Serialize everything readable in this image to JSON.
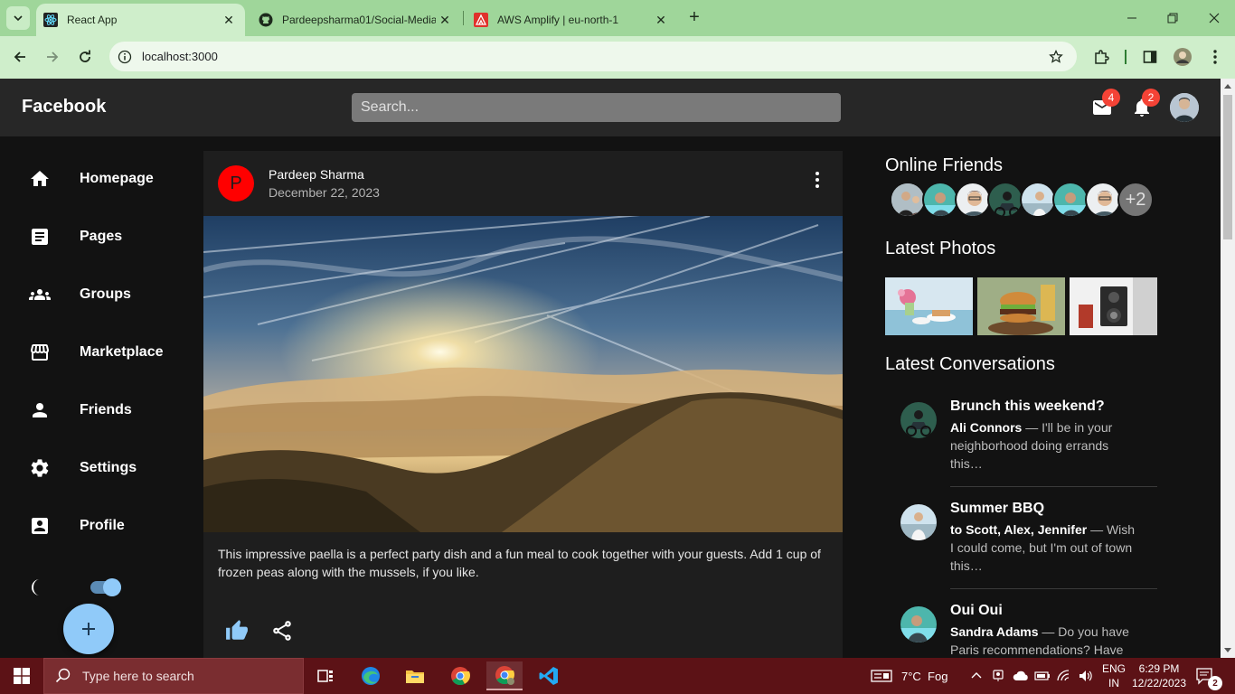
{
  "browser": {
    "tabs": [
      {
        "title": "React App",
        "icon": "react-icon",
        "active": true
      },
      {
        "title": "Pardeepsharma01/Social-Media",
        "icon": "github-icon",
        "active": false
      },
      {
        "title": "AWS Amplify | eu-north-1",
        "icon": "aws-amplify-icon",
        "active": false
      }
    ],
    "url": "localhost:3000",
    "accent": "#9fd69a"
  },
  "header": {
    "logo": "Facebook",
    "search_placeholder": "Search...",
    "mail_count": "4",
    "notification_count": "2"
  },
  "sidebar": {
    "items": [
      {
        "label": "Homepage",
        "icon": "home-icon"
      },
      {
        "label": "Pages",
        "icon": "article-icon"
      },
      {
        "label": "Groups",
        "icon": "groups-icon"
      },
      {
        "label": "Marketplace",
        "icon": "storefront-icon"
      },
      {
        "label": "Friends",
        "icon": "person-icon"
      },
      {
        "label": "Settings",
        "icon": "settings-icon"
      },
      {
        "label": "Profile",
        "icon": "account-box-icon"
      }
    ],
    "dark_mode_on": true
  },
  "post": {
    "avatar_letter": "P",
    "author": "Pardeep Sharma",
    "date": "December 22, 2023",
    "text": "This impressive paella is a perfect party dish and a fun meal to cook together with your guests. Add 1 cup of frozen peas along with the mussels, if you like."
  },
  "rightbar": {
    "online_title": "Online Friends",
    "online_more": "+2",
    "photos_title": "Latest Photos",
    "conversations_title": "Latest Conversations",
    "conversations": [
      {
        "title": "Brunch this weekend?",
        "who": "Ali Connors",
        "body": " — I'll be in your neighborhood doing errands this…"
      },
      {
        "title": "Summer BBQ",
        "who": "to Scott, Alex, Jennifer",
        "body": " — Wish I could come, but I'm out of town this…"
      },
      {
        "title": "Oui Oui",
        "who": "Sandra Adams",
        "body": " — Do you have Paris recommendations? Have you ever…"
      }
    ]
  },
  "taskbar": {
    "search_placeholder": "Type here to search",
    "weather": "7°C  Fog",
    "lang_top": "ENG",
    "lang_bottom": "IN",
    "time": "6:29 PM",
    "date": "12/22/2023",
    "notifications": "2"
  }
}
